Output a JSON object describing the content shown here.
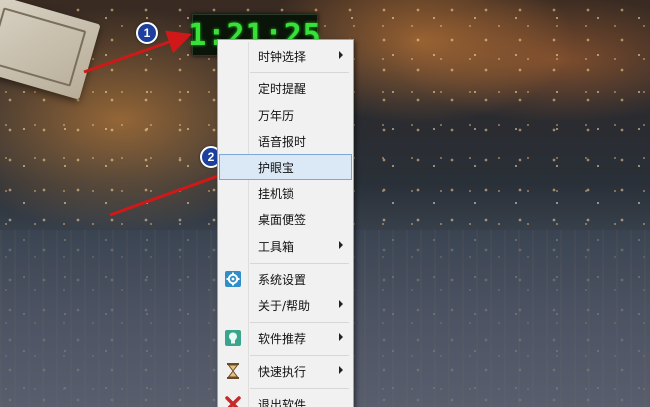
{
  "clock": {
    "time": "1:21:25"
  },
  "annotations": [
    {
      "number": "1",
      "target": "clock"
    },
    {
      "number": "2",
      "target": "eye-protection"
    }
  ],
  "menu": {
    "items": [
      {
        "label": "时钟选择",
        "submenu": true
      },
      {
        "label": "定时提醒",
        "submenu": false
      },
      {
        "label": "万年历",
        "submenu": false
      },
      {
        "label": "语音报时",
        "submenu": false
      },
      {
        "label": "护眼宝",
        "submenu": false,
        "highlighted": true
      },
      {
        "label": "挂机锁",
        "submenu": false
      },
      {
        "label": "桌面便签",
        "submenu": false
      },
      {
        "label": "工具箱",
        "submenu": true
      },
      {
        "label": "系统设置",
        "submenu": false,
        "icon": "gear-icon"
      },
      {
        "label": "关于/帮助",
        "submenu": true
      },
      {
        "label": "软件推荐",
        "submenu": true,
        "icon": "lightbulb-icon"
      },
      {
        "label": "快速执行",
        "submenu": true,
        "icon": "hourglass-icon"
      },
      {
        "label": "退出软件",
        "submenu": false,
        "icon": "exit-x-icon"
      }
    ]
  },
  "colors": {
    "clock_digits": "#3ae03a",
    "menu_highlight": "#dbe8f6",
    "arrow": "#d01818",
    "badge": "#1d3f9e"
  }
}
